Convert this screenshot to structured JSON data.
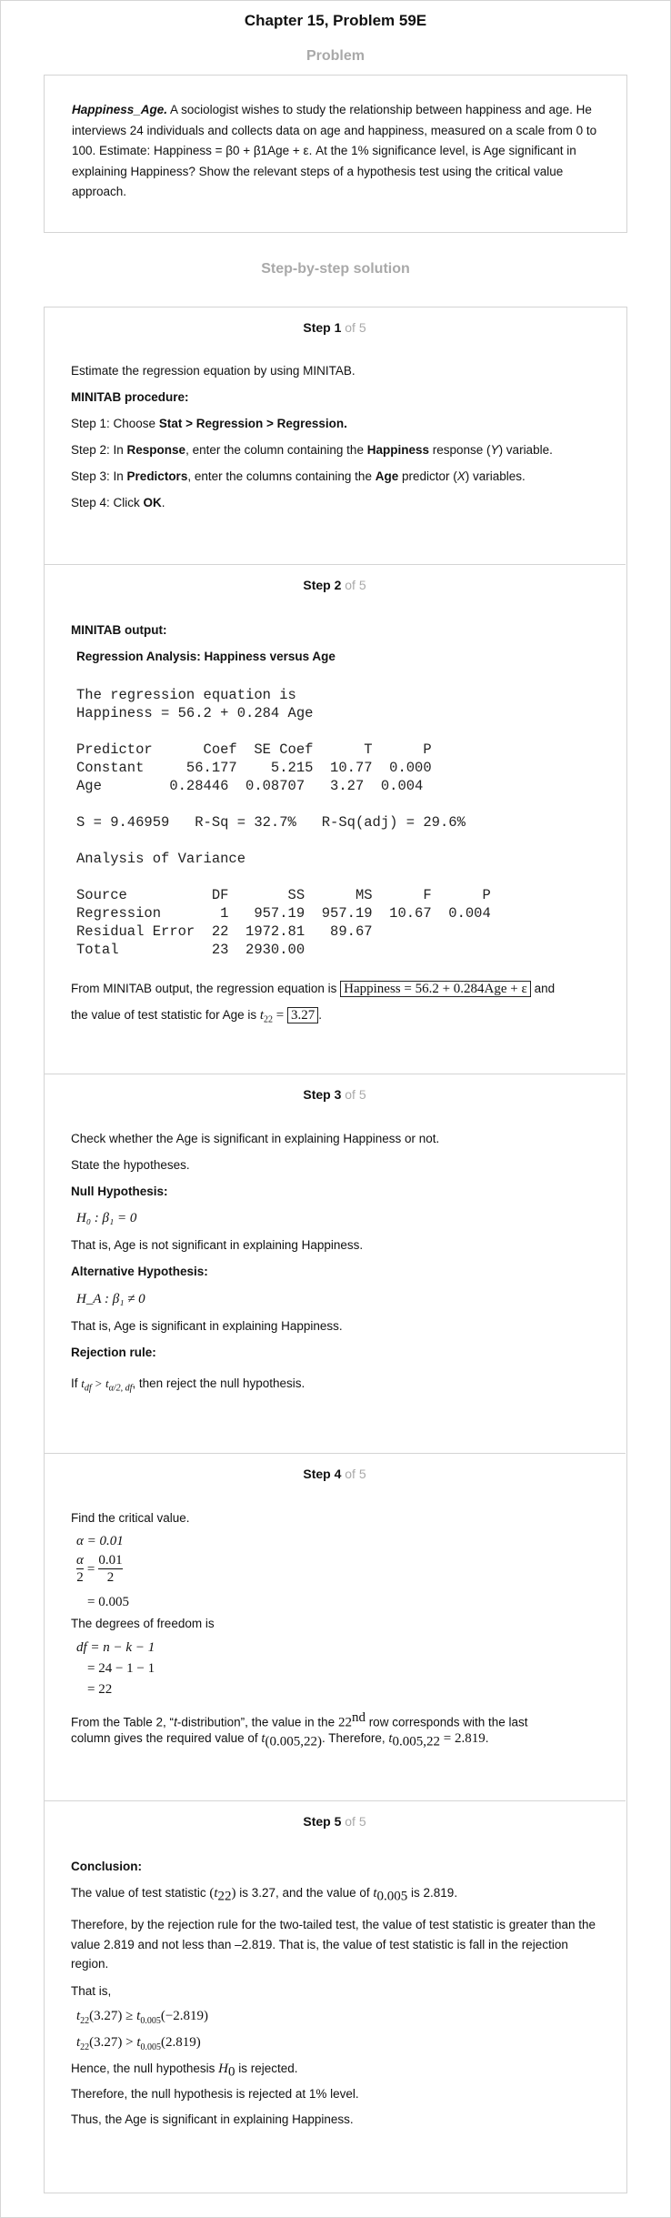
{
  "header": {
    "chapter_title": "Chapter 15, Problem 59E"
  },
  "problem": {
    "heading": "Problem",
    "lead": "Happiness_Age.",
    "text": " A sociologist wishes to study the relationship between happiness and age. He interviews 24 individuals and collects data on age and happiness, measured on a scale from 0 to 100. Estimate: Happiness = β0 + β1Age + ε. At the 1% significance level, is Age significant in explaining Happiness? Show the relevant steps of a hypothesis test using the critical value approach."
  },
  "solution": {
    "heading": "Step-by-step solution"
  },
  "steps": [
    {
      "num": "Step 1",
      "of": " of 5"
    },
    {
      "num": "Step 2",
      "of": " of 5"
    },
    {
      "num": "Step 3",
      "of": " of 5"
    },
    {
      "num": "Step 4",
      "of": " of 5"
    },
    {
      "num": "Step 5",
      "of": " of 5"
    }
  ],
  "step1": {
    "intro": "Estimate the regression equation by using MINITAB.",
    "proc_heading": "MINITAB procedure:",
    "s1_a": "Step 1: Choose ",
    "s1_b": "Stat > Regression > Regression.",
    "s2_a": "Step 2: In ",
    "s2_b": "Response",
    "s2_c": ", enter the column containing the ",
    "s2_d": "Happiness",
    "s2_e": " response (",
    "s2_f": "Y",
    "s2_g": ") variable.",
    "s3_a": "Step 3: In ",
    "s3_b": "Predictors",
    "s3_c": ", enter the columns containing the ",
    "s3_d": "Age",
    "s3_e": " predictor (",
    "s3_f": "X",
    "s3_g": ") variables.",
    "s4_a": "Step 4: Click ",
    "s4_b": "OK",
    "s4_c": "."
  },
  "step2": {
    "output_heading": "MINITAB output:",
    "reg_title": "Regression Analysis: Happiness versus Age",
    "output_lines": [
      "The regression equation is",
      "Happiness = 56.2 + 0.284 Age",
      "",
      "Predictor      Coef  SE Coef      T      P",
      "Constant     56.177    5.215  10.77  0.000",
      "Age        0.28446  0.08707   3.27  0.004",
      "",
      "S = 9.46959   R-Sq = 32.7%   R-Sq(adj) = 29.6%",
      "",
      "Analysis of Variance",
      "",
      "Source          DF       SS      MS      F      P",
      "Regression       1   957.19  957.19  10.67  0.004",
      "Residual Error  22  1972.81   89.67",
      "Total           23  2930.00"
    ],
    "concl_a": "From MINITAB output, the regression equation is ",
    "equation": "Happiness = 56.2 + 0.284Age + ε",
    "concl_b": " and",
    "concl_c": "the value of test statistic for Age is ",
    "t_sym": "t",
    "t_sub": "22",
    "t_val": "3.27"
  },
  "step3": {
    "l1": "Check whether the Age is significant in explaining Happiness or not.",
    "l2": "State the hypotheses.",
    "null_heading": "Null Hypothesis:",
    "null_eq": "H₀ : β₁ = 0",
    "null_text": "That is, Age is not significant in explaining Happiness.",
    "alt_heading": "Alternative Hypothesis:",
    "alt_eq": "H_A : β₁ ≠ 0",
    "alt_text": "That is, Age is significant in explaining Happiness.",
    "rule_heading": "Rejection rule:",
    "rule_a": "If ",
    "rule_b": ", then reject the null hypothesis."
  },
  "step4": {
    "l1": "Find the critical value.",
    "alpha": "α = 0.01",
    "half_num": "0.01",
    "half_den": "2",
    "half_val": "= 0.005",
    "dof_intro": "The degrees of freedom is",
    "dof1": "df = n − k − 1",
    "dof2": "= 24 − 1 − 1",
    "dof3": "= 22",
    "table_a": "From the Table 2, “",
    "table_b": "t",
    "table_c": "-distribution”, the value in the ",
    "row_num": "22",
    "row_sup": "nd",
    "table_d": " row corresponds with the last",
    "table_e": "column gives the required value of ",
    "table_f": ". Therefore, ",
    "crit_val": "= 2.819",
    "table_g": "."
  },
  "step5": {
    "concl_heading": "Conclusion:",
    "l1_a": "The value of test statistic ",
    "l1_b": " is 3.27, and the value of ",
    "l1_c": " is 2.819.",
    "para": "Therefore, by the rejection rule for the two-tailed test, the value of test statistic is greater than the value 2.819 and not less than –2.819. That is, the value of test statistic is fall in the rejection region.",
    "that_is": "That is,",
    "ineq1_rhs": "(−2.819)",
    "ineq2_rhs": "(2.819)",
    "hence_a": "Hence, the null hypothesis ",
    "hence_b": " is rejected.",
    "reject": "Therefore, the null hypothesis is rejected at 1% level.",
    "final": "Thus, the Age is significant in explaining Happiness."
  }
}
